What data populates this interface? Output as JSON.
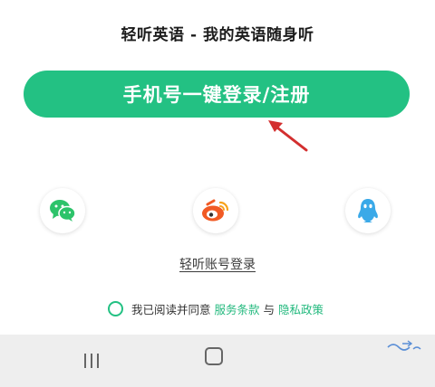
{
  "dialog": {
    "title": "轻听英语 - 我的英语随身听",
    "primary_button_label": "手机号一键登录/注册",
    "account_login_link": "轻听账号登录"
  },
  "social_login": [
    {
      "name": "wechat",
      "icon": "wechat-icon",
      "color": "#2dc36a"
    },
    {
      "name": "weibo",
      "icon": "weibo-icon",
      "color": "#f15a24"
    },
    {
      "name": "qq",
      "icon": "qq-icon",
      "color": "#3aa9e8"
    }
  ],
  "agreement": {
    "prefix": "我已阅读并同意",
    "terms_link": "服务条款",
    "conjunction": "与",
    "privacy_link": "隐私政策"
  },
  "colors": {
    "accent": "#23c183",
    "annotation_arrow": "#d32f2f",
    "nav_bar": "#eeeeee"
  }
}
